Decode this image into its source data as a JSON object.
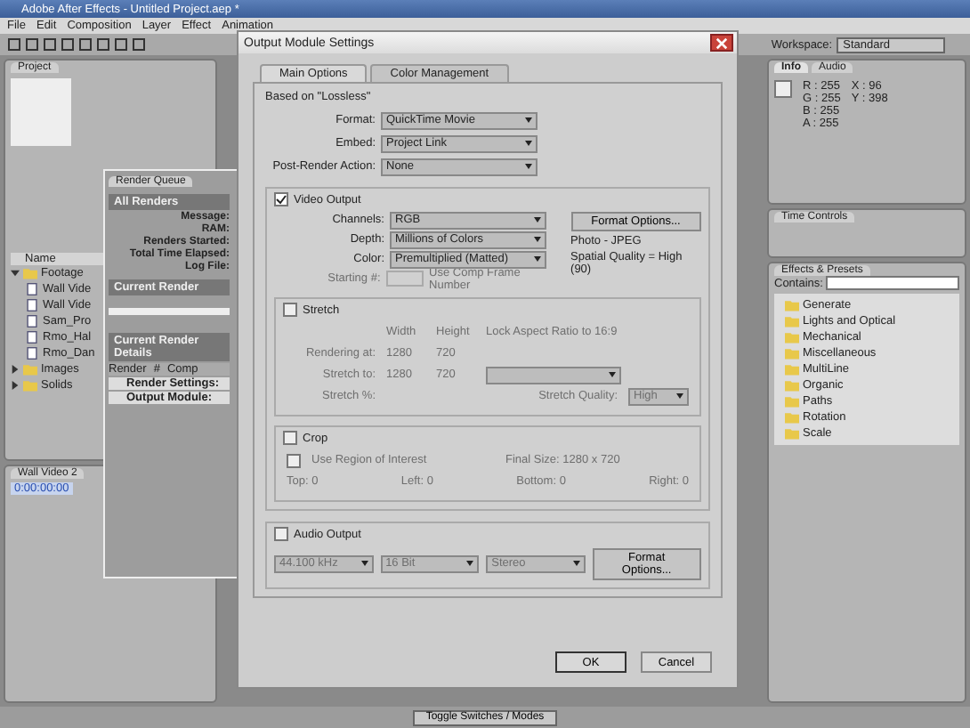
{
  "app": {
    "title": "Adobe After Effects - Untitled Project.aep *",
    "menu": [
      "File",
      "Edit",
      "Composition",
      "Layer",
      "Effect",
      "Animation"
    ],
    "workspace_label": "Workspace:",
    "workspace": "Standard"
  },
  "project": {
    "tab": "Project",
    "column": "Name",
    "items": [
      {
        "name": "Footage",
        "kind": "folder",
        "expanded": true,
        "children": [
          {
            "name": "Wall Vide",
            "kind": "file"
          },
          {
            "name": "Wall Vide",
            "kind": "file"
          },
          {
            "name": "Sam_Pro",
            "kind": "file"
          },
          {
            "name": "Rmo_Hal",
            "kind": "file"
          },
          {
            "name": "Rmo_Dan",
            "kind": "file"
          }
        ]
      },
      {
        "name": "Images",
        "kind": "folder",
        "expanded": false
      },
      {
        "name": "Solids",
        "kind": "folder",
        "expanded": false
      }
    ]
  },
  "render_queue": {
    "tab": "Render Queue",
    "all_renders": "All Renders",
    "fields": [
      "Message:",
      "RAM:",
      "Renders Started:",
      "Total Time Elapsed:",
      "Log File:"
    ],
    "current_render": "Current Render",
    "current_render_details": "Current Render Details",
    "columns": [
      "Render",
      "#",
      "Comp"
    ],
    "rows": [
      "Render Settings:",
      "Output Module:"
    ]
  },
  "timeline": {
    "tab": "Wall Video 2",
    "timecode": "0:00:00:00",
    "toggle_button": "Toggle Switches / Modes"
  },
  "info": {
    "tabs": [
      {
        "label": "Info",
        "selected": true
      },
      {
        "label": "Audio",
        "selected": false
      }
    ],
    "channels": [
      "R : 255",
      "G : 255",
      "B : 255",
      "A : 255"
    ],
    "coords": [
      "X : 96",
      "Y : 398"
    ]
  },
  "time_controls": {
    "tab": "Time Controls"
  },
  "effects": {
    "tab": "Effects & Presets",
    "search_label": "Contains:",
    "items": [
      "Generate",
      "Lights and Optical",
      "Mechanical",
      "Miscellaneous",
      "MultiLine",
      "Organic",
      "Paths",
      "Rotation",
      "Scale"
    ]
  },
  "dialog": {
    "title": "Output Module Settings",
    "tabs": [
      {
        "label": "Main Options",
        "selected": true
      },
      {
        "label": "Color Management",
        "selected": false
      }
    ],
    "based_on": "Based on \"Lossless\"",
    "top_fields": [
      {
        "label": "Format:",
        "value": "QuickTime Movie"
      },
      {
        "label": "Embed:",
        "value": "Project Link"
      },
      {
        "label": "Post-Render Action:",
        "value": "None"
      }
    ],
    "video_output": {
      "label": "Video Output",
      "checked": true,
      "fields": [
        {
          "label": "Channels:",
          "value": "RGB"
        },
        {
          "label": "Depth:",
          "value": "Millions of Colors"
        },
        {
          "label": "Color:",
          "value": "Premultiplied (Matted)"
        }
      ],
      "format_options": "Format Options...",
      "codec": "Photo - JPEG",
      "quality": "Spatial Quality = High (90)",
      "starting_label": "Starting #:",
      "use_comp_frame": "Use Comp Frame Number"
    },
    "stretch": {
      "label": "Stretch",
      "checked": false,
      "width": "Width",
      "height": "Height",
      "lock": "Lock Aspect Ratio to 16:9",
      "rendering_label": "Rendering at:",
      "rendering": [
        "1280",
        "720"
      ],
      "stretch_label": "Stretch to:",
      "stretch_to": [
        "1280",
        "720"
      ],
      "percent_label": "Stretch %:",
      "quality_label": "Stretch Quality:",
      "quality": "High"
    },
    "crop": {
      "label": "Crop",
      "checked": false,
      "roi": "Use Region of Interest",
      "roi_checked": false,
      "final_size": "Final Size: 1280 x 720",
      "sides": [
        {
          "label": "Top:",
          "value": "0"
        },
        {
          "label": "Left:",
          "value": "0"
        },
        {
          "label": "Bottom:",
          "value": "0"
        },
        {
          "label": "Right:",
          "value": "0"
        }
      ]
    },
    "audio": {
      "label": "Audio Output",
      "checked": false,
      "selects": [
        "44.100 kHz",
        "16 Bit",
        "Stereo"
      ],
      "format_options": "Format Options..."
    },
    "buttons": [
      {
        "label": "OK",
        "default": true
      },
      {
        "label": "Cancel",
        "default": false
      }
    ]
  }
}
